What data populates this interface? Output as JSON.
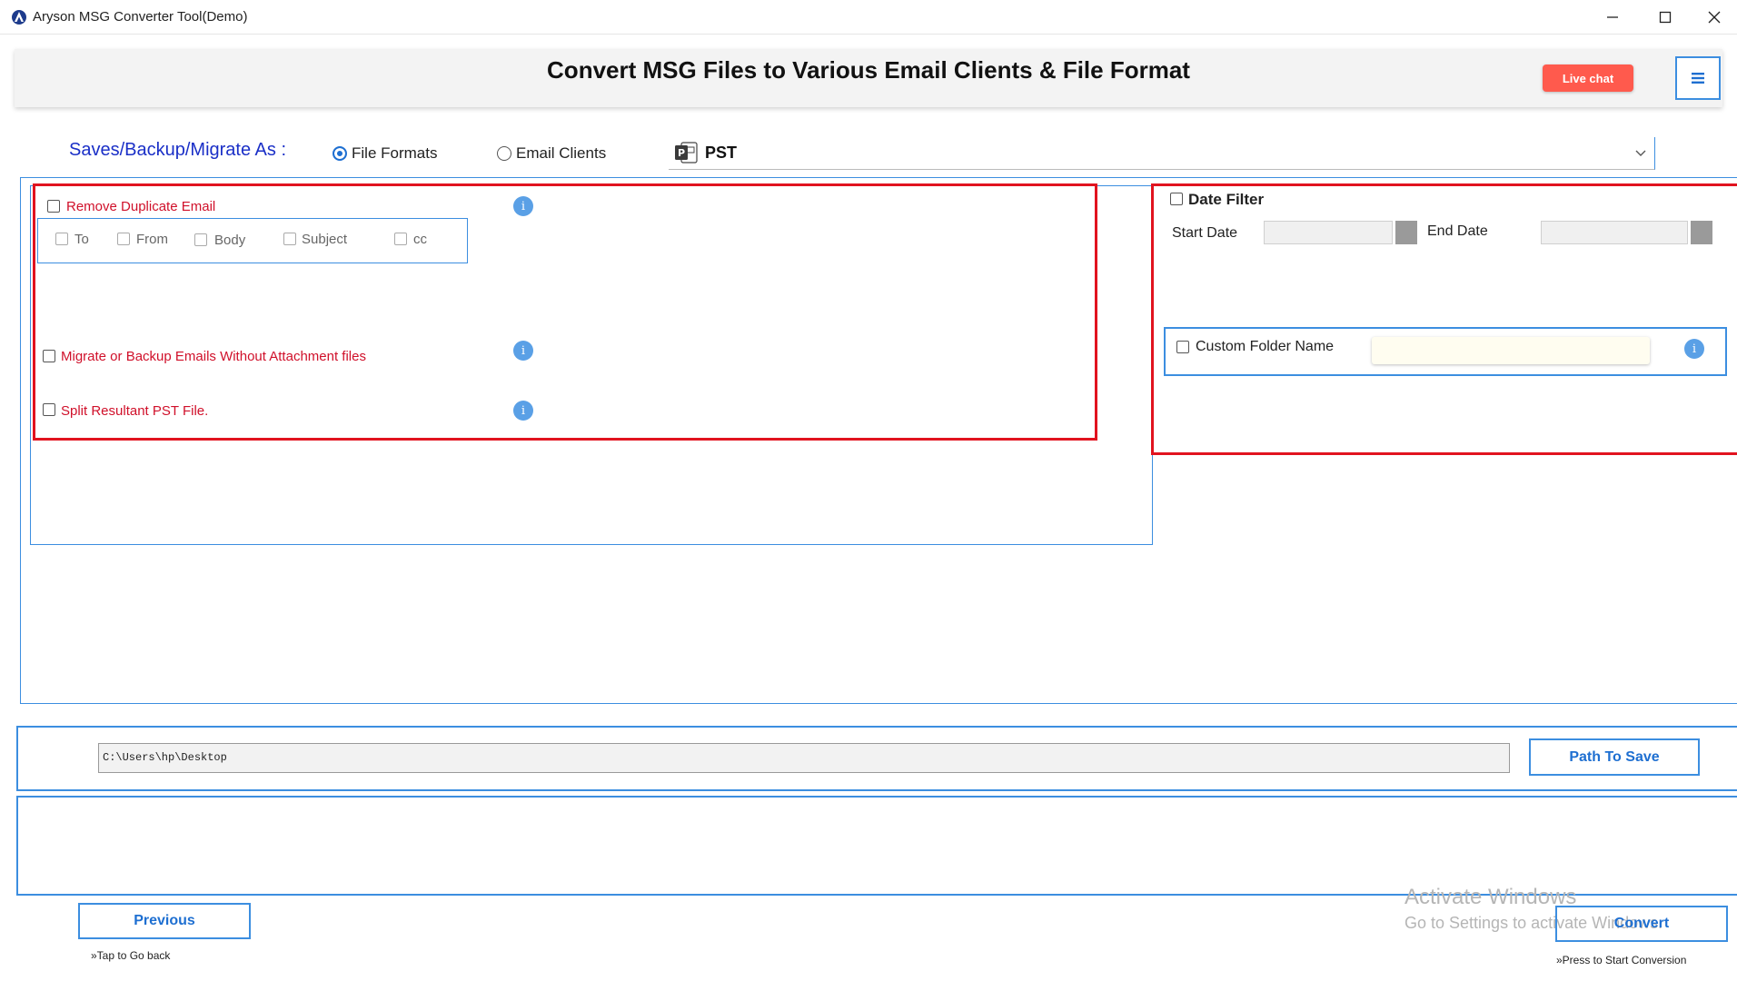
{
  "window": {
    "title": "Aryson MSG Converter Tool(Demo)"
  },
  "header": {
    "title": "Convert MSG Files to Various Email Clients & File Format",
    "live_chat": "Live chat"
  },
  "save_as": {
    "label": "Saves/Backup/Migrate As :",
    "options": [
      {
        "label": "File Formats",
        "selected": true
      },
      {
        "label": "Email Clients",
        "selected": false
      }
    ],
    "selected_format": "PST"
  },
  "options": {
    "remove_duplicate": {
      "label": "Remove Duplicate Email",
      "checked": false,
      "fields": [
        {
          "label": "To"
        },
        {
          "label": "From"
        },
        {
          "label": "Body"
        },
        {
          "label": "Subject"
        },
        {
          "label": "cc"
        }
      ]
    },
    "without_attachments": {
      "label": "Migrate or Backup Emails Without Attachment files",
      "checked": false
    },
    "split_pst": {
      "label": "Split Resultant PST File.",
      "checked": false
    }
  },
  "date_filter": {
    "label": "Date Filter",
    "checked": false,
    "start_label": "Start Date",
    "end_label": "End Date",
    "start_value": "",
    "end_value": ""
  },
  "custom_folder": {
    "label": "Custom Folder Name",
    "checked": false,
    "value": ""
  },
  "path": {
    "value": "C:\\Users\\hp\\Desktop",
    "button": "Path To Save"
  },
  "footer": {
    "previous": "Previous",
    "previous_hint": "»Tap to Go back",
    "convert": "Convert",
    "convert_hint": "»Press to Start Conversion"
  },
  "watermark": {
    "line1": "Activate Windows",
    "line2": "Go to Settings to activate Windows."
  },
  "colors": {
    "accent_blue": "#3c8ee0",
    "highlight_red": "#e1131f",
    "live_chat": "#ff5a4d",
    "label_blue": "#1a2fc7"
  }
}
